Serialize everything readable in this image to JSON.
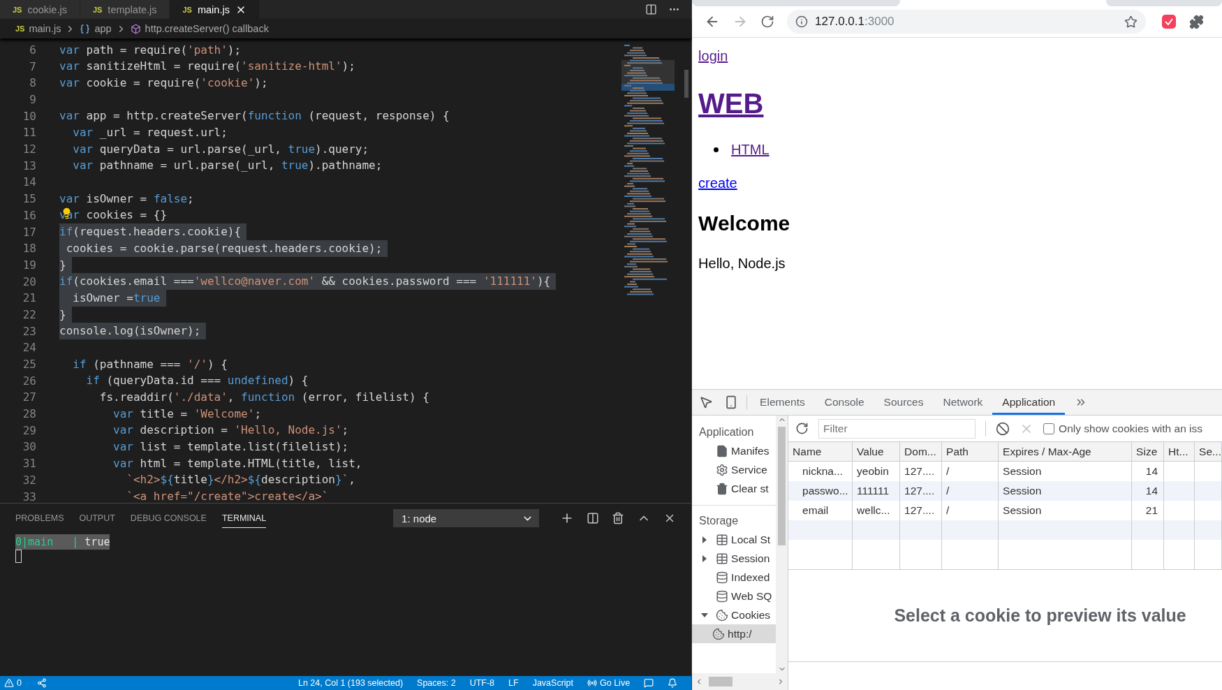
{
  "editor": {
    "tabs": [
      {
        "badge": "JS",
        "label": "cookie.js",
        "selected": false
      },
      {
        "badge": "JS",
        "label": "template.js",
        "selected": false
      },
      {
        "badge": "JS",
        "label": "main.js",
        "selected": true
      }
    ],
    "breadcrumb": [
      {
        "kind": "file",
        "badge": "JS",
        "label": "main.js"
      },
      {
        "kind": "variable",
        "label": "app"
      },
      {
        "kind": "method",
        "label": "http.createServer() callback"
      }
    ],
    "lines": [
      {
        "number": "6",
        "selected": false,
        "tokens": [
          {
            "kind": "k",
            "text": "var"
          },
          {
            "kind": "p",
            "text": " path = require("
          },
          {
            "kind": "s",
            "text": "'path'"
          },
          {
            "kind": "p",
            "text": ");"
          }
        ]
      },
      {
        "number": "7",
        "selected": false,
        "tokens": [
          {
            "kind": "k",
            "text": "var"
          },
          {
            "kind": "p",
            "text": " sanitizeHtml = require("
          },
          {
            "kind": "s",
            "text": "'sanitize-html'"
          },
          {
            "kind": "p",
            "text": ");"
          }
        ]
      },
      {
        "number": "8",
        "selected": false,
        "tokens": [
          {
            "kind": "k",
            "text": "var"
          },
          {
            "kind": "p",
            "text": " cookie = require("
          },
          {
            "kind": "s",
            "text": "'cookie'"
          },
          {
            "kind": "p",
            "text": ");"
          }
        ]
      },
      {
        "number": "9",
        "selected": false
      },
      {
        "number": "10",
        "selected": false,
        "tokens": [
          {
            "kind": "k",
            "text": "var"
          },
          {
            "kind": "p",
            "text": " app = http.createServer("
          },
          {
            "kind": "k",
            "text": "function"
          },
          {
            "kind": "p",
            "text": " (request, response) {"
          }
        ]
      },
      {
        "number": "11",
        "selected": false,
        "tokens": [
          {
            "kind": "k",
            "text": "  var"
          },
          {
            "kind": "p",
            "text": " _url = request.url;"
          }
        ]
      },
      {
        "number": "12",
        "selected": false,
        "tokens": [
          {
            "kind": "k",
            "text": "  var"
          },
          {
            "kind": "p",
            "text": " queryData = url.parse(_url, "
          },
          {
            "kind": "k",
            "text": "true"
          },
          {
            "kind": "p",
            "text": ").query;"
          }
        ]
      },
      {
        "number": "13",
        "selected": false,
        "tokens": [
          {
            "kind": "k",
            "text": "  var"
          },
          {
            "kind": "p",
            "text": " pathname = url.parse(_url, "
          },
          {
            "kind": "k",
            "text": "true"
          },
          {
            "kind": "p",
            "text": ").pathname;"
          }
        ]
      },
      {
        "number": "14",
        "selected": false
      },
      {
        "number": "15",
        "selected": false,
        "tokens": [
          {
            "kind": "k",
            "text": "var"
          },
          {
            "kind": "p",
            "text": " isOwner = "
          },
          {
            "kind": "k",
            "text": "false"
          },
          {
            "kind": "p",
            "text": ";"
          }
        ]
      },
      {
        "number": "16",
        "selected": false,
        "lightbulb": true,
        "tokens": [
          {
            "kind": "k",
            "text": "var"
          },
          {
            "kind": "p",
            "text": " cookies = {}"
          }
        ]
      },
      {
        "number": "17",
        "selected": true,
        "tokens": [
          {
            "kind": "k",
            "text": "if"
          },
          {
            "kind": "p",
            "text": "(request.headers.cookie){"
          }
        ]
      },
      {
        "number": "18",
        "selected": true,
        "tokens": [
          {
            "kind": "p",
            "text": " cookies = cookie.parse(request.headers.cookie);"
          }
        ]
      },
      {
        "number": "19",
        "selected": true,
        "tokens": [
          {
            "kind": "p",
            "text": "}"
          }
        ]
      },
      {
        "number": "20",
        "selected": true,
        "tokens": [
          {
            "kind": "k",
            "text": "if"
          },
          {
            "kind": "p",
            "text": "(cookies.email ==="
          },
          {
            "kind": "s",
            "text": "'wellco@naver.com'"
          },
          {
            "kind": "p",
            "text": " && cookies.password === "
          },
          {
            "kind": "s",
            "text": "'111111'"
          },
          {
            "kind": "p",
            "text": "){"
          }
        ]
      },
      {
        "number": "21",
        "selected": true,
        "tokens": [
          {
            "kind": "p",
            "text": "  isOwner ="
          },
          {
            "kind": "k",
            "text": "true"
          }
        ]
      },
      {
        "number": "22",
        "selected": true,
        "tokens": [
          {
            "kind": "p",
            "text": "}"
          }
        ]
      },
      {
        "number": "23",
        "selected": true,
        "tokens": [
          {
            "kind": "p",
            "text": "console.log(isOwner);"
          }
        ]
      },
      {
        "number": "24",
        "selected": false
      },
      {
        "number": "25",
        "selected": false,
        "tokens": [
          {
            "kind": "k",
            "text": "  if"
          },
          {
            "kind": "p",
            "text": " (pathname === "
          },
          {
            "kind": "s",
            "text": "'/'"
          },
          {
            "kind": "p",
            "text": ") {"
          }
        ]
      },
      {
        "number": "26",
        "selected": false,
        "tokens": [
          {
            "kind": "k",
            "text": "    if"
          },
          {
            "kind": "p",
            "text": " (queryData.id === "
          },
          {
            "kind": "k",
            "text": "undefined"
          },
          {
            "kind": "p",
            "text": ") {"
          }
        ]
      },
      {
        "number": "27",
        "selected": false,
        "tokens": [
          {
            "kind": "p",
            "text": "      fs.readdir("
          },
          {
            "kind": "s",
            "text": "'./data'"
          },
          {
            "kind": "p",
            "text": ", "
          },
          {
            "kind": "k",
            "text": "function"
          },
          {
            "kind": "p",
            "text": " (error, filelist) {"
          }
        ]
      },
      {
        "number": "28",
        "selected": false,
        "tokens": [
          {
            "kind": "k",
            "text": "        var"
          },
          {
            "kind": "p",
            "text": " title = "
          },
          {
            "kind": "s",
            "text": "'Welcome'"
          },
          {
            "kind": "p",
            "text": ";"
          }
        ]
      },
      {
        "number": "29",
        "selected": false,
        "tokens": [
          {
            "kind": "k",
            "text": "        var"
          },
          {
            "kind": "p",
            "text": " description = "
          },
          {
            "kind": "s",
            "text": "'Hello, Node.js'"
          },
          {
            "kind": "p",
            "text": ";"
          }
        ]
      },
      {
        "number": "30",
        "selected": false,
        "tokens": [
          {
            "kind": "k",
            "text": "        var"
          },
          {
            "kind": "p",
            "text": " list = template.list(filelist);"
          }
        ]
      },
      {
        "number": "31",
        "selected": false,
        "tokens": [
          {
            "kind": "k",
            "text": "        var"
          },
          {
            "kind": "p",
            "text": " html = template.HTML(title, list,"
          }
        ]
      },
      {
        "number": "32",
        "selected": false,
        "tokens": [
          {
            "kind": "s",
            "text": "          `<h2>"
          },
          {
            "kind": "k",
            "text": "${"
          },
          {
            "kind": "p",
            "text": "title"
          },
          {
            "kind": "k",
            "text": "}"
          },
          {
            "kind": "s",
            "text": "</h2>"
          },
          {
            "kind": "k",
            "text": "${"
          },
          {
            "kind": "p",
            "text": "description"
          },
          {
            "kind": "k",
            "text": "}"
          },
          {
            "kind": "s",
            "text": "`"
          },
          {
            "kind": "p",
            "text": ","
          }
        ]
      },
      {
        "number": "33",
        "selected": false,
        "tokens": [
          {
            "kind": "s",
            "text": "          `<a href=\"/create\">create</a>`"
          }
        ]
      }
    ]
  },
  "panel": {
    "tabs": [
      {
        "label": "PROBLEMS",
        "selected": false
      },
      {
        "label": "OUTPUT",
        "selected": false
      },
      {
        "label": "DEBUG CONSOLE",
        "selected": false
      },
      {
        "label": "TERMINAL",
        "selected": true
      }
    ],
    "terminal_select": "1: node",
    "terminal_lines": [
      {
        "selected": true,
        "segments": [
          {
            "kind": "accent",
            "text": "0|main   |"
          },
          {
            "kind": "plain",
            "text": " true"
          }
        ]
      }
    ]
  },
  "status_bar": {
    "problems": "0",
    "items": [
      "Ln 24, Col 1 (193 selected)",
      "Spaces: 2",
      "UTF-8",
      "LF",
      "JavaScript"
    ],
    "go_live": "Go Live"
  },
  "browser": {
    "forward_disabled": true,
    "url_host": "127.0.0.1",
    "url_rest": ":3000",
    "page": {
      "login": {
        "text": "login",
        "visited": true
      },
      "title": {
        "text": "WEB",
        "visited": true
      },
      "list": [
        {
          "text": "HTML",
          "visited": true
        }
      ],
      "create": {
        "text": "create",
        "visited": false
      },
      "heading": "Welcome",
      "body": "Hello, Node.js"
    }
  },
  "devtools": {
    "tabs": [
      {
        "label": "Elements",
        "selected": false
      },
      {
        "label": "Console",
        "selected": false
      },
      {
        "label": "Sources",
        "selected": false
      },
      {
        "label": "Network",
        "selected": false
      },
      {
        "label": "Application",
        "selected": true
      }
    ],
    "sidebar": [
      {
        "title": "Application",
        "items": [
          {
            "kind": "manifest",
            "label": "Manifes",
            "selected": false
          },
          {
            "kind": "worker",
            "label": "Service",
            "selected": false
          },
          {
            "kind": "clear",
            "label": "Clear st",
            "selected": false
          }
        ]
      },
      {
        "title": "Storage",
        "items": [
          {
            "kind": "table",
            "label": "Local St",
            "expanded": false,
            "selected": false
          },
          {
            "kind": "table",
            "label": "Session",
            "expanded": false,
            "selected": false
          },
          {
            "kind": "database",
            "label": "Indexed",
            "selected": false
          },
          {
            "kind": "database",
            "label": "Web SQ",
            "selected": false
          },
          {
            "kind": "cookie",
            "label": "Cookies",
            "expanded": true,
            "selected": false,
            "children": [
              {
                "kind": "cookie",
                "label": "http:/",
                "selected": true
              }
            ]
          }
        ]
      }
    ],
    "toolbar": {
      "filter_placeholder": "Filter",
      "delete_disabled": true,
      "only_issues": {
        "label": "Only show cookies with an iss",
        "checked": false
      }
    },
    "table": {
      "columns": [
        "Name",
        "Value",
        "Dom...",
        "Path",
        "Expires / Max-Age",
        "Size",
        "Ht...",
        "Se..."
      ],
      "rows": [
        [
          "nickna...",
          "yeobin",
          "127....",
          "/",
          "Session",
          "14"
        ],
        [
          "passwo...",
          "111111",
          "127....",
          "/",
          "Session",
          "14"
        ],
        [
          "email",
          "wellc...",
          "127....",
          "/",
          "Session",
          "21"
        ]
      ]
    },
    "preview": "Select a cookie to preview its value"
  }
}
